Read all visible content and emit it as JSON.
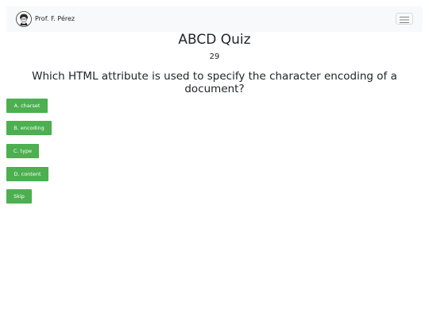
{
  "navbar": {
    "brand_name": "Prof. F. Pérez",
    "avatar_icon": "professor-avatar-icon",
    "toggler_icon": "hamburger-menu-icon"
  },
  "quiz": {
    "title": "ABCD Quiz",
    "counter": "29",
    "question": "Which HTML attribute is used to specify the character encoding of a document?",
    "answers": [
      "A. charset",
      "B. encoding",
      "C. type",
      "D. content"
    ],
    "skip_label": "Skip"
  },
  "colors": {
    "button_green": "#4caf50",
    "navbar_bg": "#f8f9fa",
    "text": "#212529"
  }
}
